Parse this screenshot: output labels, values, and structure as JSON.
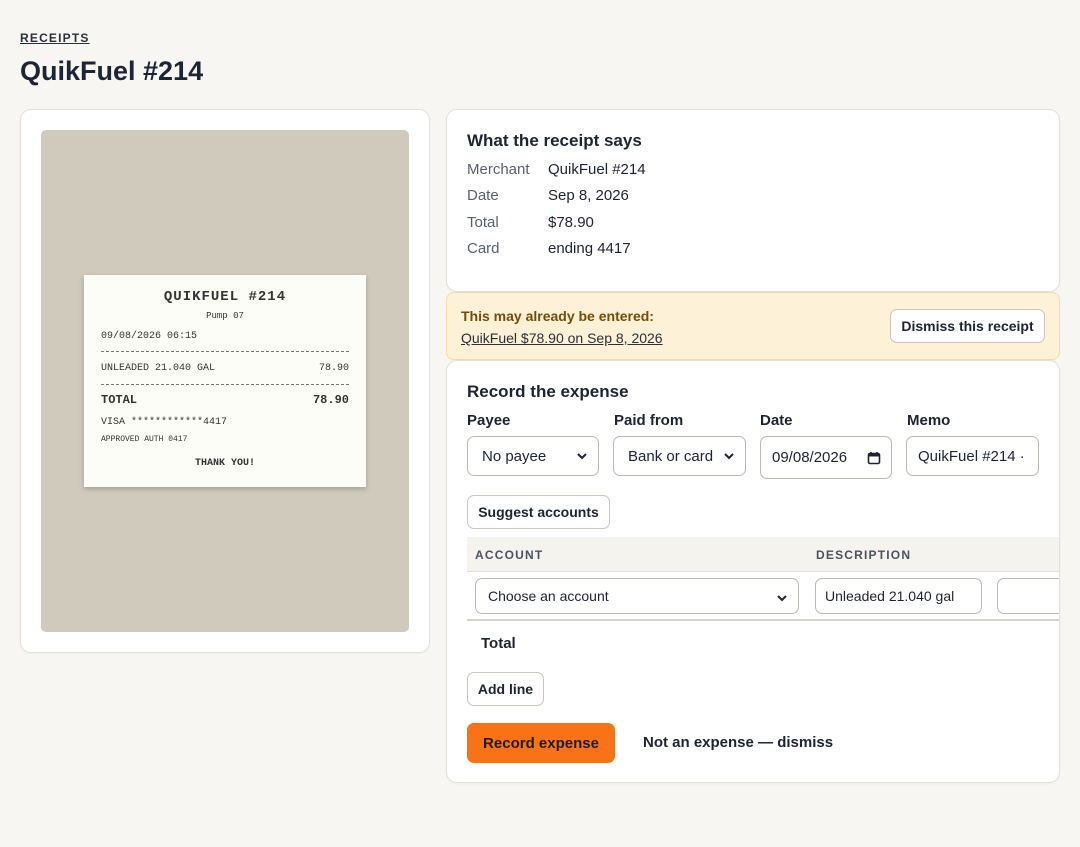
{
  "breadcrumb": "RECEIPTS",
  "page_title": "QuikFuel #214",
  "receipt_image": {
    "store": "QUIKFUEL #214",
    "pump": "Pump 07",
    "datetime": "09/08/2026 06:15",
    "item": "UNLEADED 21.040 GAL",
    "item_amount": "78.90",
    "total_label": "TOTAL",
    "total_amount": "78.90",
    "card_line": "VISA ************4417",
    "auth_line": "APPROVED AUTH 0417",
    "thanks": "THANK YOU!"
  },
  "summary": {
    "heading": "What the receipt says",
    "rows": [
      {
        "key": "Merchant",
        "value": "QuikFuel #214"
      },
      {
        "key": "Date",
        "value": "Sep 8, 2026"
      },
      {
        "key": "Total",
        "value": "$78.90"
      },
      {
        "key": "Card",
        "value": "ending 4417"
      }
    ]
  },
  "duplicate_warning": {
    "title": "This may already be entered:",
    "link": "QuikFuel $78.90 on Sep 8, 2026",
    "dismiss_label": "Dismiss this receipt"
  },
  "expense_form": {
    "heading": "Record the expense",
    "payee": {
      "label": "Payee",
      "value": "No payee"
    },
    "paid_from": {
      "label": "Paid from",
      "value": "Bank or card"
    },
    "date": {
      "label": "Date",
      "value": "09/08/2026"
    },
    "memo": {
      "label": "Memo",
      "value": "QuikFuel #214 ·"
    },
    "suggest_label": "Suggest accounts",
    "table": {
      "col_account": "ACCOUNT",
      "col_description": "DESCRIPTION",
      "rows": [
        {
          "account": "Choose an account",
          "description": "Unleaded 21.040 gal",
          "amount": ""
        }
      ],
      "total_label": "Total"
    },
    "add_line_label": "Add line",
    "submit_label": "Record expense",
    "dismiss_label": "Not an expense — dismiss"
  },
  "colors": {
    "accent": "#f97316",
    "warning_bg": "#fdf1d7",
    "warning_text": "#7a4b08",
    "page_bg": "#f8f6f2"
  }
}
